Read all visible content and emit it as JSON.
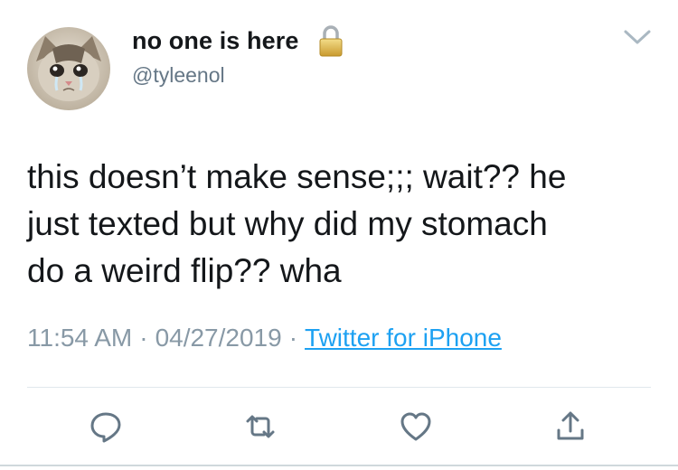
{
  "tweet": {
    "author": {
      "display_name": "no one is here",
      "username": "@tyleenol",
      "protected_icon": "lock-icon",
      "avatar": "crying-cat-avatar"
    },
    "menu_icon": "chevron-down-icon",
    "text": "this doesn’t make sense;;; wait?? he\njust texted but why did my stomach\ndo a weird flip?? wha",
    "time": "11:54 AM",
    "date": "04/27/2019",
    "separator": "·",
    "source": "Twitter for iPhone",
    "actions": [
      {
        "name": "reply",
        "icon": "comment-icon"
      },
      {
        "name": "retweet",
        "icon": "retweet-icon"
      },
      {
        "name": "like",
        "icon": "heart-icon"
      },
      {
        "name": "share",
        "icon": "share-icon"
      }
    ],
    "colors": {
      "text": "#14171a",
      "secondary": "#657786",
      "meta": "#8899a6",
      "link": "#1da1f2",
      "icon": "#657786"
    }
  }
}
